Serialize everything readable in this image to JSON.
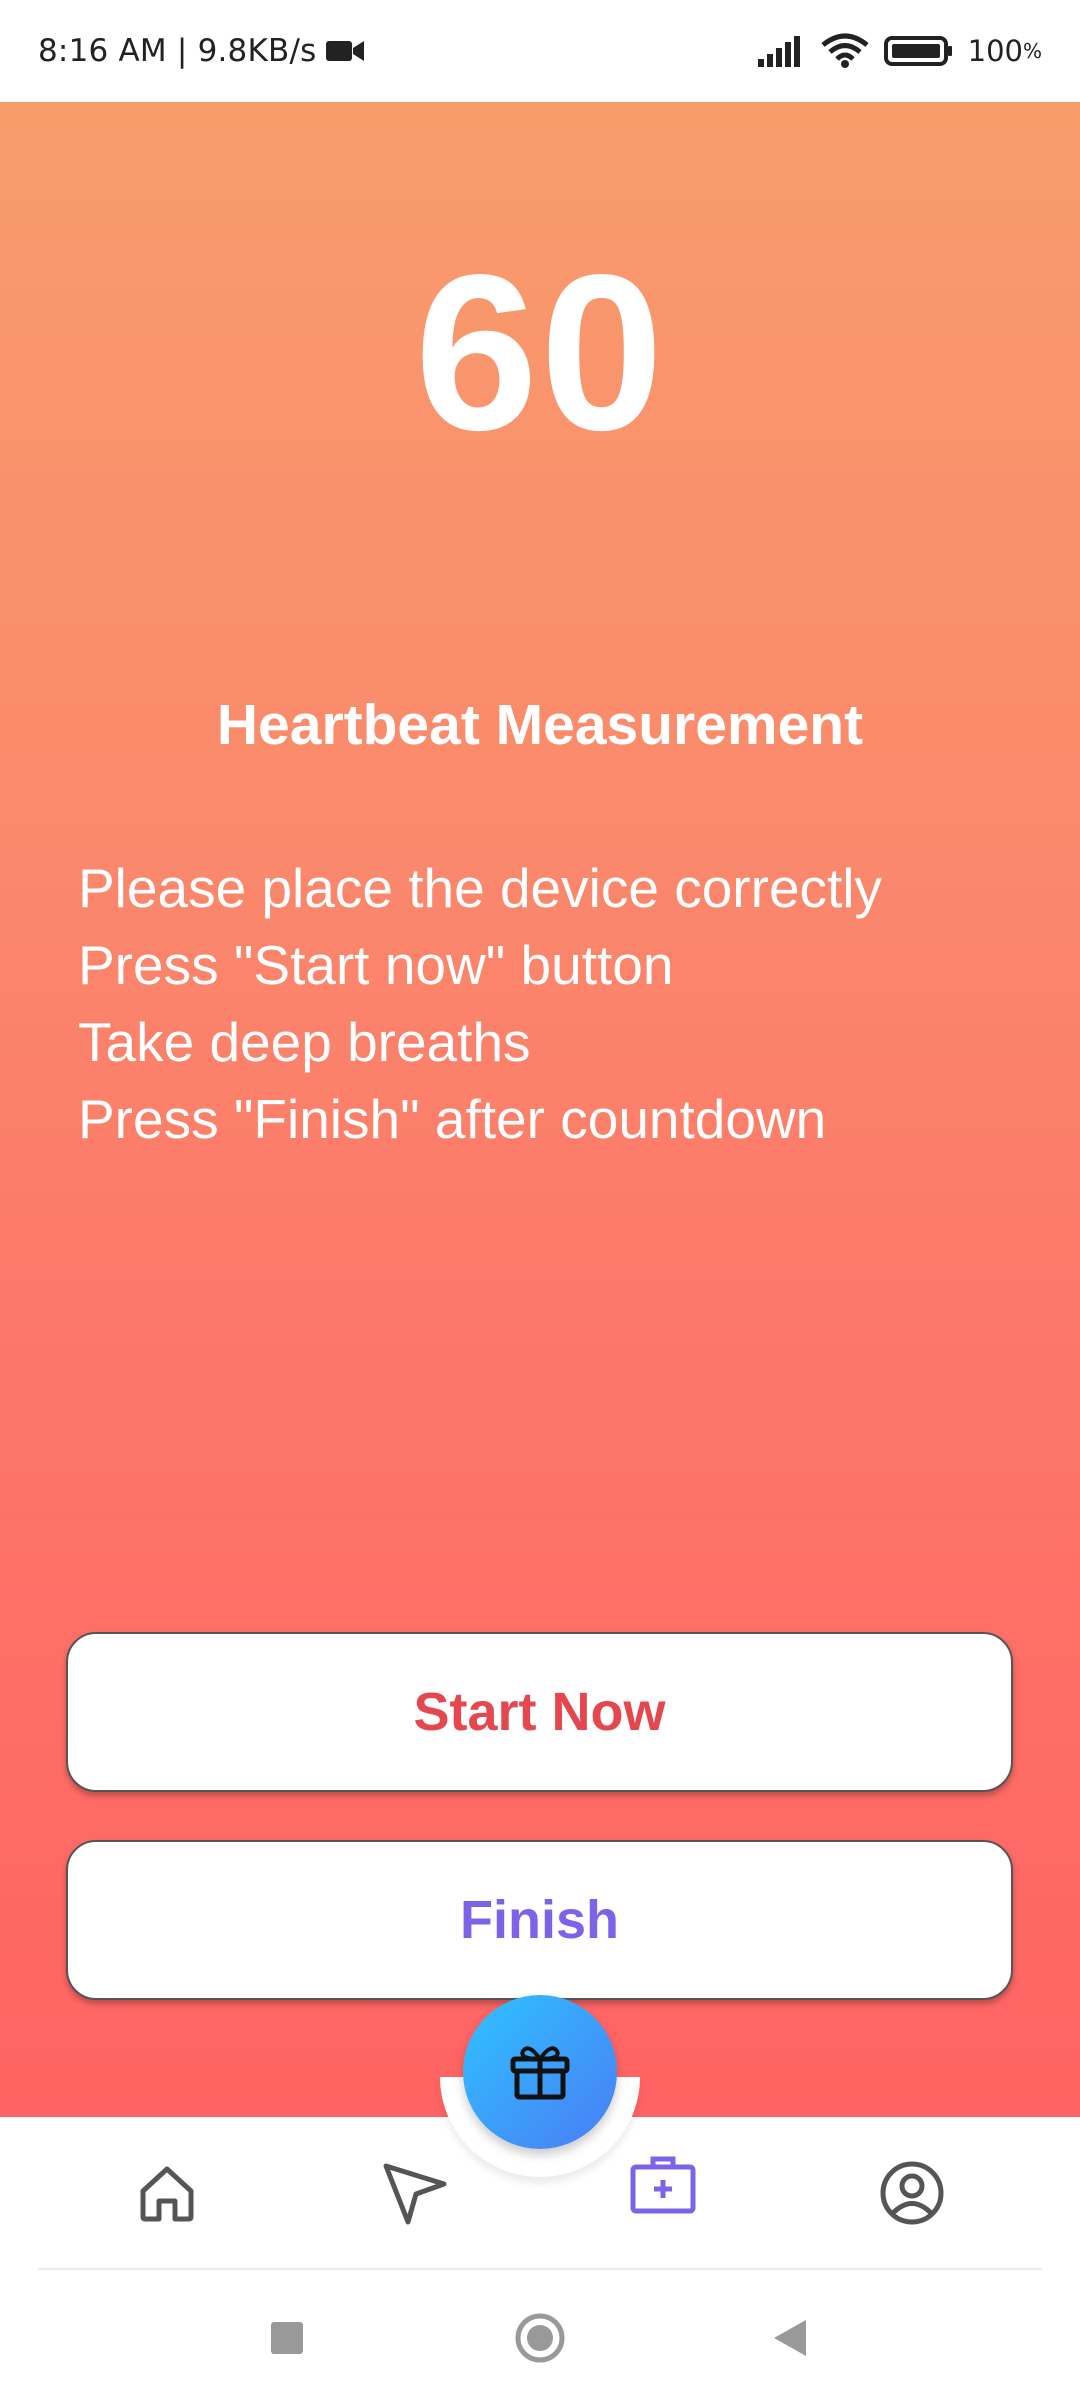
{
  "status_bar": {
    "time_speed": "8:16 AM | 9.8KB/s",
    "battery_value": "100",
    "battery_unit": "%"
  },
  "screen": {
    "countdown": "60",
    "title": "Heartbeat Measurement",
    "instructions": [
      "Please place the device correctly",
      "Press \"Start now\" button",
      "Take deep breaths",
      "Press \"Finish\" after countdown"
    ],
    "start_button": "Start Now",
    "finish_button": "Finish"
  },
  "colors": {
    "gradient_top": "#f89c6c",
    "gradient_bottom": "#ff6363",
    "start_text": "#e5474e",
    "finish_text": "#7d63e8",
    "fab_start": "#2ec3ff",
    "fab_end": "#4a7cf5",
    "active_nav": "#7d63e8"
  },
  "bottom_nav": {
    "items": [
      {
        "icon": "home-icon",
        "active": false
      },
      {
        "icon": "send-icon",
        "active": false
      },
      {
        "icon": "medical-kit-icon",
        "active": true
      },
      {
        "icon": "profile-icon",
        "active": false
      }
    ],
    "fab_icon": "gift-icon"
  },
  "system_nav": {
    "buttons": [
      "recent-apps-icon",
      "home-circle-icon",
      "back-icon"
    ]
  }
}
